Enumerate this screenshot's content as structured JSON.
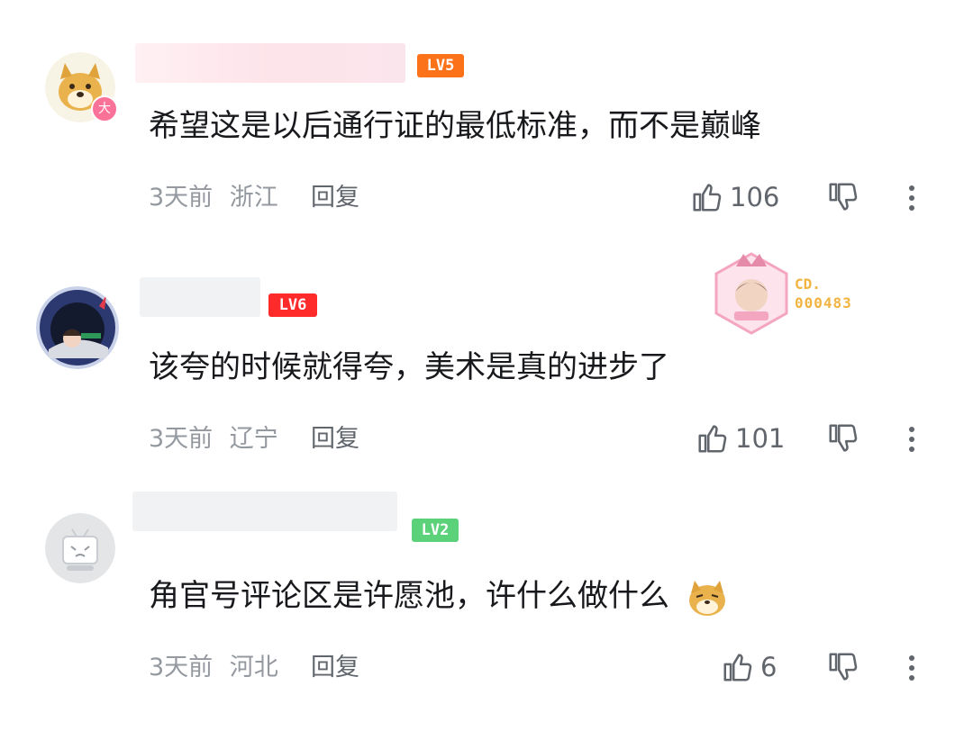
{
  "comments": [
    {
      "level": "LV5",
      "level_color": "#fb7219",
      "badge": "大",
      "text": "希望这是以后通行证的最低标准，而不是巅峰",
      "time": "3天前",
      "location": "浙江",
      "reply": "回复",
      "likes": "106"
    },
    {
      "level": "LV6",
      "level_color": "#ff2b2b",
      "fan_badge_top": "CD.",
      "fan_badge_bottom": "000483",
      "text": "该夸的时候就得夸，美术是真的进步了",
      "time": "3天前",
      "location": "辽宁",
      "reply": "回复",
      "likes": "101"
    },
    {
      "level": "LV2",
      "level_color": "#5bd27a",
      "text": "角官号评论区是许愿池，许什么做什么",
      "time": "3天前",
      "location": "河北",
      "reply": "回复",
      "likes": "6"
    }
  ],
  "icons": {
    "like": "thumb-up-icon",
    "dislike": "thumb-down-icon",
    "more": "more-vertical-icon",
    "emoji": "doge-emoji"
  }
}
